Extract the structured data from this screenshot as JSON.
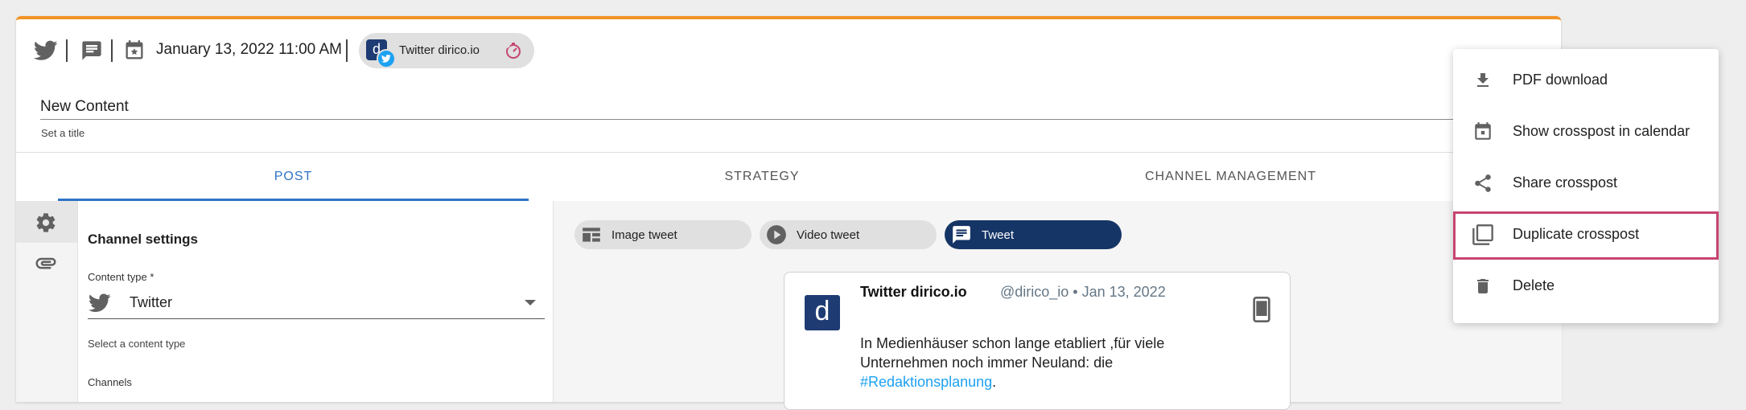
{
  "header": {
    "date": "January 13, 2022 11:00 AM",
    "channel_chip": "Twitter dirico.io"
  },
  "title_field": {
    "value": "New Content",
    "hint": "Set a title"
  },
  "tabs": [
    {
      "label": "POST"
    },
    {
      "label": "STRATEGY"
    },
    {
      "label": "CHANNEL MANAGEMENT"
    }
  ],
  "channel_settings": {
    "title": "Channel settings",
    "content_type_label": "Content type *",
    "content_type_value": "Twitter",
    "content_type_hint": "Select a content type",
    "channels_label": "Channels"
  },
  "tweet_types": [
    {
      "label": "Image tweet"
    },
    {
      "label": "Video tweet"
    },
    {
      "label": "Tweet"
    }
  ],
  "preview": {
    "avatar_letter": "d",
    "name": "Twitter dirico.io",
    "handle_date": "@dirico_io • Jan 13, 2022",
    "text": "In Medienhäuser schon lange etabliert ,für viele Unternehmen noch immer Neuland: die",
    "hashtag": "#Redaktionsplanung",
    "trailing": "."
  },
  "menu": {
    "items": [
      {
        "label": "PDF download",
        "icon": "download-icon"
      },
      {
        "label": "Show crosspost in calendar",
        "icon": "calendar-icon"
      },
      {
        "label": "Share crosspost",
        "icon": "share-icon"
      },
      {
        "label": "Duplicate crosspost",
        "icon": "duplicate-icon"
      },
      {
        "label": "Delete",
        "icon": "trash-icon"
      }
    ]
  },
  "colors": {
    "accent_top": "#f39325",
    "tab_active": "#2f73c6",
    "chip_selected": "#153566",
    "highlight": "#c6456f",
    "twitter_blue": "#1da1f2"
  }
}
